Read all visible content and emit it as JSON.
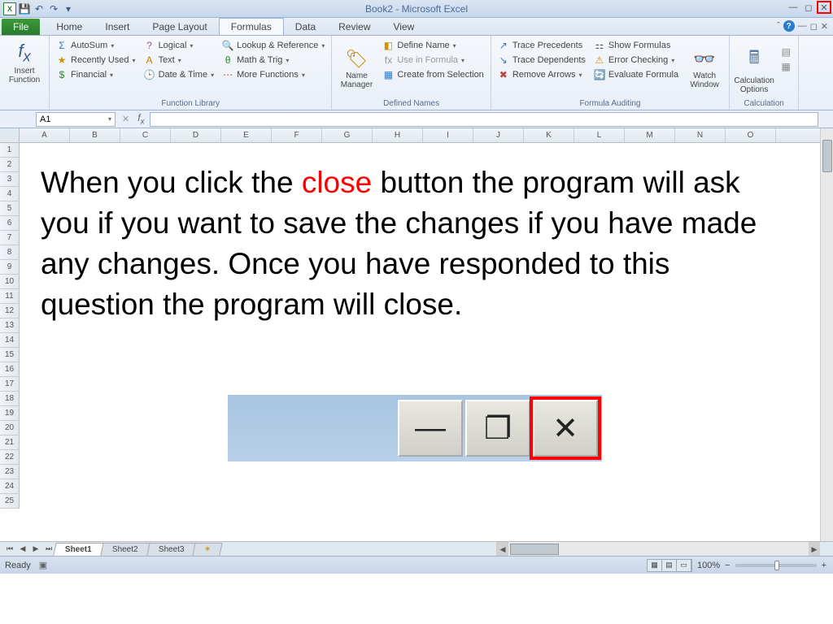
{
  "title": "Book2 - Microsoft Excel",
  "qat": {
    "save": "💾",
    "undo": "↶",
    "redo": "↷"
  },
  "tabs": {
    "file": "File",
    "items": [
      "Home",
      "Insert",
      "Page Layout",
      "Formulas",
      "Data",
      "Review",
      "View"
    ],
    "active": "Formulas"
  },
  "ribbon": {
    "insert_fn": {
      "label": "Insert Function",
      "icon": "fx"
    },
    "library": {
      "autosum": "AutoSum",
      "recently": "Recently Used",
      "financial": "Financial",
      "logical": "Logical",
      "text": "Text",
      "datetime": "Date & Time",
      "lookup": "Lookup & Reference",
      "math": "Math & Trig",
      "more": "More Functions",
      "label": "Function Library"
    },
    "names": {
      "manager": "Name Manager",
      "define": "Define Name",
      "use": "Use in Formula",
      "create": "Create from Selection",
      "label": "Defined Names"
    },
    "audit": {
      "prec": "Trace Precedents",
      "dep": "Trace Dependents",
      "remove": "Remove Arrows",
      "show": "Show Formulas",
      "err": "Error Checking",
      "eval": "Evaluate Formula",
      "watch": "Watch Window",
      "label": "Formula Auditing"
    },
    "calc": {
      "options": "Calculation Options",
      "label": "Calculation"
    }
  },
  "namebox": "A1",
  "columns": [
    "A",
    "B",
    "C",
    "D",
    "E",
    "F",
    "G",
    "H",
    "I",
    "J",
    "K",
    "L",
    "M",
    "N",
    "O"
  ],
  "rows": [
    "1",
    "2",
    "3",
    "4",
    "5",
    "6",
    "7",
    "8",
    "9",
    "10",
    "11",
    "12",
    "13",
    "14",
    "15",
    "16",
    "17",
    "18",
    "19",
    "20",
    "21",
    "22",
    "23",
    "24",
    "25"
  ],
  "overlay": {
    "pre": "When you click the ",
    "red": "close",
    "post": " button the program will ask you if you want to save the changes if you have made any changes. Once you have responded to this question the program will close."
  },
  "sheets": [
    "Sheet1",
    "Sheet2",
    "Sheet3"
  ],
  "status": {
    "ready": "Ready",
    "zoom": "100%"
  }
}
